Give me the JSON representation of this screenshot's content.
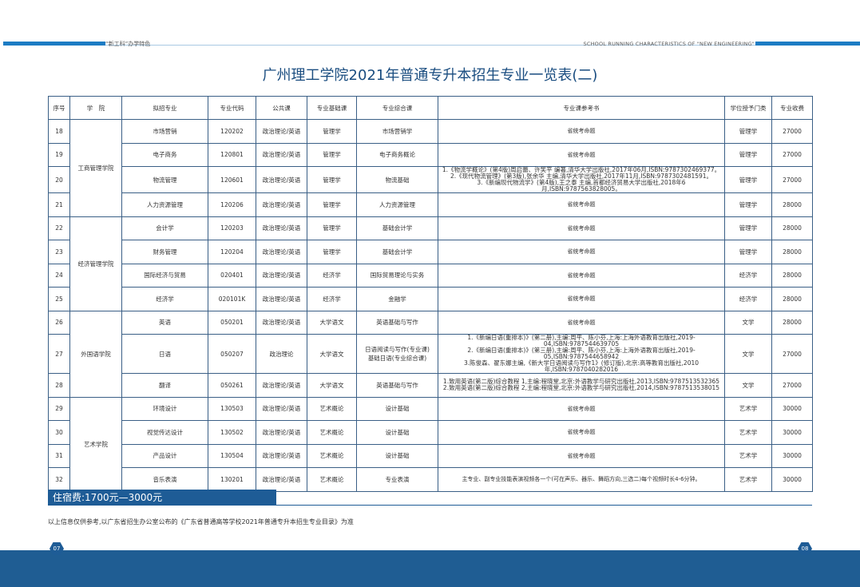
{
  "header": {
    "left": "“新工科”办学特色",
    "right": "SCHOOL RUNNING CHARACTERISTICS OF \"NEW ENGINEERING\""
  },
  "title": "广州理工学院2021年普通专升本招生专业一览表(二)",
  "columns": [
    "序号",
    "学　院",
    "拟招专业",
    "专业代码",
    "公共课",
    "专业基础课",
    "专业综合课",
    "专业课参考书",
    "学位授予门类",
    "专业收费"
  ],
  "rows": [
    {
      "no": "18",
      "major": "市场营销",
      "code": "120202",
      "public": "政治理论/英语",
      "basic": "管理学",
      "comp": "市场营销学",
      "ref": "省统考命题",
      "degree": "管理学",
      "fee": "27000"
    },
    {
      "no": "19",
      "major": "电子商务",
      "code": "120801",
      "public": "政治理论/英语",
      "basic": "管理学",
      "comp": "电子商务概论",
      "ref": "省统考命题",
      "degree": "管理学",
      "fee": "27000"
    },
    {
      "no": "20",
      "major": "物流管理",
      "code": "120601",
      "public": "政治理论/英语",
      "basic": "管理学",
      "comp": "物流基础",
      "ref": "1.《物流学概论》(第4版)周启蕾、许笑平 编著,清华大学出版社,2017年06月,ISBN:9787302469377。\n2.《现代物流管理》(第3版),张余华 主编,清华大学出版社,2017年11月,ISBN:9787302481591。\n3.《新编现代物流学》(第4版),王之泰 主编,首都经济贸易大学出版社,2018年6月,ISBN:9787563828005。",
      "degree": "管理学",
      "fee": "27000"
    },
    {
      "no": "21",
      "major": "人力资源管理",
      "code": "120206",
      "public": "政治理论/英语",
      "basic": "管理学",
      "comp": "人力资源管理",
      "ref": "省统考命题",
      "degree": "管理学",
      "fee": "28000"
    },
    {
      "no": "22",
      "major": "会计学",
      "code": "120203",
      "public": "政治理论/英语",
      "basic": "管理学",
      "comp": "基础会计学",
      "ref": "省统考命题",
      "degree": "管理学",
      "fee": "28000"
    },
    {
      "no": "23",
      "major": "财务管理",
      "code": "120204",
      "public": "政治理论/英语",
      "basic": "管理学",
      "comp": "基础会计学",
      "ref": "省统考命题",
      "degree": "管理学",
      "fee": "28000"
    },
    {
      "no": "24",
      "major": "国际经济与贸易",
      "code": "020401",
      "public": "政治理论/英语",
      "basic": "经济学",
      "comp": "国际贸易理论与实务",
      "ref": "省统考命题",
      "degree": "经济学",
      "fee": "28000"
    },
    {
      "no": "25",
      "major": "经济学",
      "code": "020101K",
      "public": "政治理论/英语",
      "basic": "经济学",
      "comp": "金融学",
      "ref": "省统考命题",
      "degree": "经济学",
      "fee": "28000"
    },
    {
      "no": "26",
      "major": "英语",
      "code": "050201",
      "public": "政治理论/英语",
      "basic": "大学语文",
      "comp": "英语基础与写作",
      "ref": "省统考命题",
      "degree": "文学",
      "fee": "28000"
    },
    {
      "no": "27",
      "major": "日语",
      "code": "050207",
      "public": "政治理论",
      "basic": "大学语文",
      "comp": "日语阅读与写作(专业课)\n基础日语(专业综合课)",
      "ref": "1.《新编日语(重排本)》(第二册),主编:周平、陈小芬,上海:上海外语教育出版社,2019-04,ISBN:9787544639705\n2.《新编日语(重排本)》(第三册),主编:周平、陈小芬,上海:上海外语教育出版社,2019-05,ISBN:9787544658942\n3.陈俊森、翟东娜主编,《新大学日语阅读与写作1》(修订版),北京:高等教育出版社,2010年,ISBN:9787040282016",
      "degree": "文学",
      "fee": "27000"
    },
    {
      "no": "28",
      "major": "翻译",
      "code": "050261",
      "public": "政治理论/英语",
      "basic": "大学语文",
      "comp": "英语基础与写作",
      "ref": "1.致用英语(第二版)综合教程 1,主编:程晓堂,北京:外语教学与研究出版社,2013,ISBN:9787513532365\n2.致用英语(第二版)综合教程 2,主编:程晓堂,北京:外语教学与研究出版社,2014,ISBN:9787513538015",
      "degree": "文学",
      "fee": "27000"
    },
    {
      "no": "29",
      "major": "环境设计",
      "code": "130503",
      "public": "政治理论/英语",
      "basic": "艺术概论",
      "comp": "设计基础",
      "ref": "省统考命题",
      "degree": "艺术学",
      "fee": "30000"
    },
    {
      "no": "30",
      "major": "视觉传达设计",
      "code": "130502",
      "public": "政治理论/英语",
      "basic": "艺术概论",
      "comp": "设计基础",
      "ref": "省统考命题",
      "degree": "艺术学",
      "fee": "30000"
    },
    {
      "no": "31",
      "major": "产品设计",
      "code": "130504",
      "public": "政治理论/英语",
      "basic": "艺术概论",
      "comp": "设计基础",
      "ref": "省统考命题",
      "degree": "艺术学",
      "fee": "30000"
    },
    {
      "no": "32",
      "major": "音乐表演",
      "code": "130201",
      "public": "政治理论/英语",
      "basic": "艺术概论",
      "comp": "专业表演",
      "ref": "主专业、副专业技能表演视频各一个(可在声乐、器乐、舞蹈方向,三选二)每个视频时长4-6分钟。",
      "degree": "艺术学",
      "fee": "30000"
    }
  ],
  "colleges": [
    "工商管理学院",
    "经济管理学院",
    "外国语学院",
    "艺术学院"
  ],
  "fee_label": "住宿费:1700元—3000元",
  "note": "以上信息仅供参考,以广东省招生办公室公布的《广东省普通高等学校2021年普通专升本招生专业目录》为准",
  "page_left": "07",
  "page_right": "08"
}
